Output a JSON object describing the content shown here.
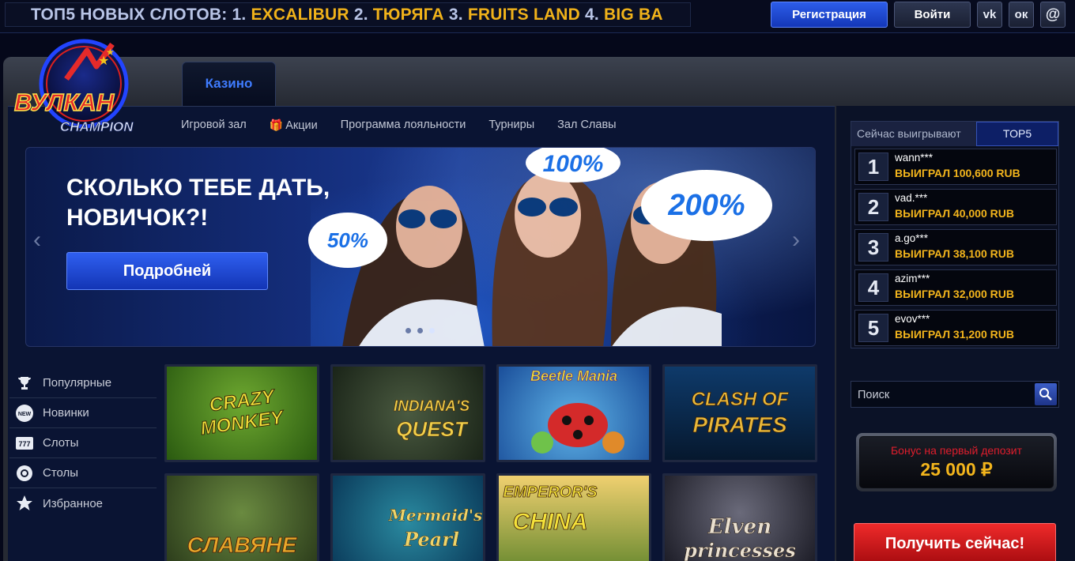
{
  "ticker": {
    "prefix": "ТОП5 НОВЫХ СЛОТОВ:",
    "items": [
      {
        "num": "1.",
        "name": "EXCALIBUR"
      },
      {
        "num": "2.",
        "name": "ТЮРЯГА"
      },
      {
        "num": "3.",
        "name": "FRUITS LAND"
      },
      {
        "num": "4.",
        "name": "BIG BA"
      }
    ]
  },
  "header": {
    "register_label": "Регистрация",
    "login_label": "Войти",
    "social": [
      {
        "icon": "vk-icon",
        "glyph": "vk"
      },
      {
        "icon": "odnoklassniki-icon",
        "glyph": "ок"
      },
      {
        "icon": "email-icon",
        "glyph": "@"
      }
    ]
  },
  "logo": {
    "line1": "ВУЛКАН",
    "line2": "CHAMPION"
  },
  "tabs": {
    "casino": "Казино"
  },
  "subnav": [
    "Игровой зал",
    "Акции",
    "Программа лояльности",
    "Турниры",
    "Зал Славы"
  ],
  "banner": {
    "title_line1": "СКОЛЬКО ТЕБЕ ДАТЬ,",
    "title_line2": "НОВИЧОК?!",
    "button_label": "Подробней",
    "bubbles": [
      "50%",
      "100%",
      "200%"
    ]
  },
  "leftmenu": [
    {
      "label": "Популярные",
      "icon": "trophy-icon"
    },
    {
      "label": "Новинки",
      "icon": "new-badge-icon",
      "badge": "NEW"
    },
    {
      "label": "Слоты",
      "icon": "slot-reels-icon",
      "badge": "777"
    },
    {
      "label": "Столы",
      "icon": "poker-chip-icon"
    },
    {
      "label": "Избранное",
      "icon": "star-icon"
    }
  ],
  "games": [
    {
      "title1": "CRAZY",
      "title2": "MONKEY"
    },
    {
      "title1": "INDIANA'S",
      "title2": "QUEST"
    },
    {
      "title1": "Beetle",
      "title2": "Mania"
    },
    {
      "title1": "CLASH OF",
      "title2": "PIRATES"
    },
    {
      "title1": "СЛАВЯНЕ",
      "title2": ""
    },
    {
      "title1": "Mermaid's",
      "title2": "Pearl"
    },
    {
      "title1": "EMPEROR'S",
      "title2": "CHINA"
    },
    {
      "title1": "Elven",
      "title2": "princesses"
    }
  ],
  "winners": {
    "tab_now": "Сейчас выигрывают",
    "tab_top": "TOP5",
    "rows": [
      {
        "rank": "1",
        "name": "wann***",
        "won": "ВЫИГРАЛ 100,600 RUB"
      },
      {
        "rank": "2",
        "name": "vad.***",
        "won": "ВЫИГРАЛ 40,000 RUB"
      },
      {
        "rank": "3",
        "name": "a.go***",
        "won": "ВЫИГРАЛ 38,100 RUB"
      },
      {
        "rank": "4",
        "name": "azim***",
        "won": "ВЫИГРАЛ 32,000 RUB"
      },
      {
        "rank": "5",
        "name": "evov***",
        "won": "ВЫИГРАЛ 31,200 RUB"
      }
    ]
  },
  "search": {
    "placeholder": "Поиск"
  },
  "bonus": {
    "title": "Бонус на первый депозит",
    "amount": "25 000 ₽"
  },
  "cta": {
    "label": "Получить сейчас!"
  },
  "colors": {
    "accent_blue": "#2c5de8",
    "gold": "#f3b51c",
    "red": "#e01d2c"
  }
}
